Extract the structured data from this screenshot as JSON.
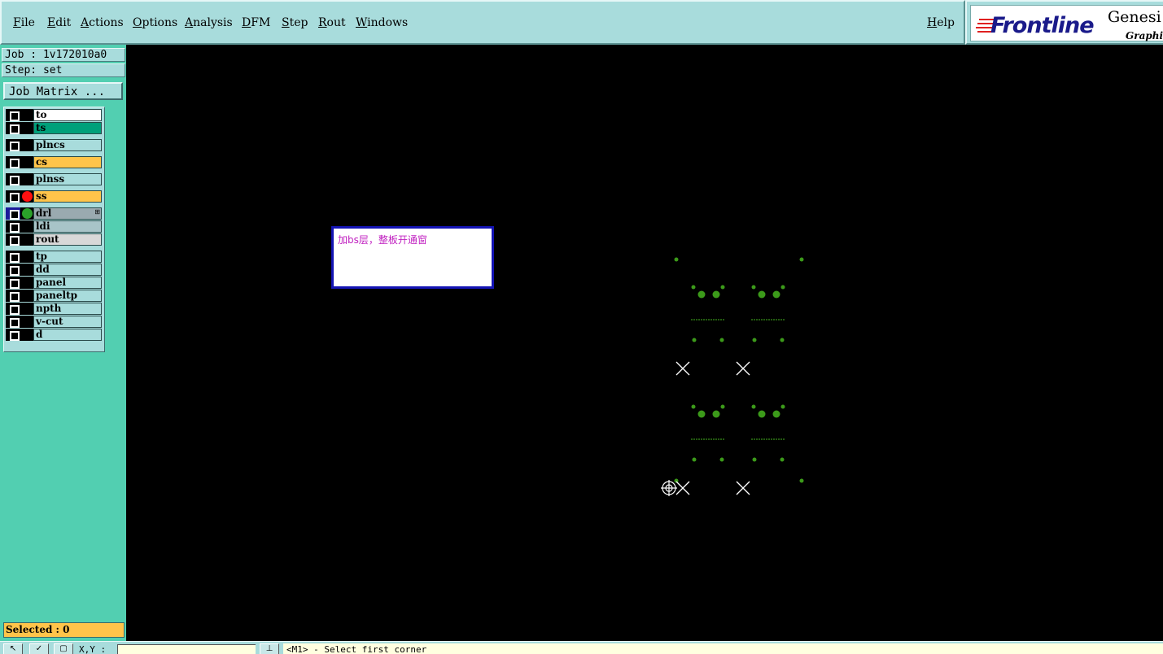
{
  "menu": {
    "file": "File",
    "edit": "Edit",
    "actions": "Actions",
    "options": "Options",
    "analysis": "Analysis",
    "dfm": "DFM",
    "step": "Step",
    "rout": "Rout",
    "windows": "Windows",
    "help": "Help"
  },
  "brand": {
    "logo": "Frontline",
    "product": "Genesi",
    "subtitle": "Graphic"
  },
  "job": {
    "job_line": "Job : 1v172010a0",
    "step_line": "Step: set",
    "matrix_button": "Job Matrix ..."
  },
  "layers": [
    {
      "name": "to",
      "color": "#ffffff",
      "dot": ""
    },
    {
      "name": "ts",
      "color": "#00a07a",
      "dot": ""
    },
    {
      "name": "plncs",
      "color": "#a8dcdc",
      "dot": ""
    },
    {
      "name": "cs",
      "color": "#ffc44a",
      "dot": ""
    },
    {
      "name": "plnss",
      "color": "#a8dcdc",
      "dot": ""
    },
    {
      "name": "ss",
      "color": "#ffc44a",
      "dot": "#ff1010"
    },
    {
      "name": "drl",
      "color": "#9aaab0",
      "dot": "#2aa02a",
      "active": true
    },
    {
      "name": "ldi",
      "color": "#a8c4c8",
      "dot": ""
    },
    {
      "name": "rout",
      "color": "#d8d8d8",
      "dot": ""
    },
    {
      "name": "tp",
      "color": "#a8dcdc",
      "dot": ""
    },
    {
      "name": "dd",
      "color": "#a8dcdc",
      "dot": ""
    },
    {
      "name": "panel",
      "color": "#a8dcdc",
      "dot": ""
    },
    {
      "name": "paneltp",
      "color": "#a8dcdc",
      "dot": ""
    },
    {
      "name": "npth",
      "color": "#a8dcdc",
      "dot": ""
    },
    {
      "name": "v-cut",
      "color": "#a8dcdc",
      "dot": ""
    },
    {
      "name": "d",
      "color": "#a8dcdc",
      "dot": ""
    }
  ],
  "selected": "Selected : 0",
  "note": "加bs层，整板开通窗",
  "status": {
    "xy_label": "X,Y :",
    "xy_value": "",
    "message": "<M1> - Select first corner"
  },
  "colors": {
    "panel_bg": "#a8dcdc",
    "side_bg": "#52cfb1",
    "feature": "#3c9a1a",
    "marker": "#ffffff"
  }
}
